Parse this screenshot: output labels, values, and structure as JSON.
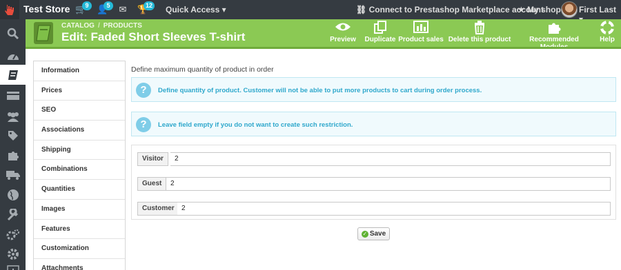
{
  "topbar": {
    "store_name": "Test Store",
    "badges": {
      "orders": "9",
      "customers": "5",
      "messages": "12"
    },
    "quick_access": "Quick Access",
    "connect": "Connect to Prestashop Marketplace account",
    "my_shop": "My shop",
    "user_name": "First Last"
  },
  "header": {
    "breadcrumb": [
      "Catalog",
      "Products"
    ],
    "title": "Edit: Faded Short Sleeves T-shirt",
    "toolbar": [
      "Preview",
      "Duplicate",
      "Product sales",
      "Delete this product",
      "Recommended Modules",
      "Help"
    ]
  },
  "tabs": [
    "Information",
    "Prices",
    "SEO",
    "Associations",
    "Shipping",
    "Combinations",
    "Quantities",
    "Images",
    "Features",
    "Customization",
    "Attachments"
  ],
  "content": {
    "heading": "Define maximum quantity of product in order",
    "alerts": [
      "Define quantity of product. Customer will not be able to put more products to cart during order process.",
      "Leave field empty if you do not want to create such restriction."
    ],
    "fields": [
      {
        "label": "Visitor",
        "value": "2"
      },
      {
        "label": "Guest",
        "value": "2"
      },
      {
        "label": "Customer",
        "value": "2"
      }
    ],
    "save_label": "Save"
  },
  "colors": {
    "header_green": "#8bc954",
    "topbar": "#353b41",
    "info_blue": "#2fa8cc",
    "badge": "#25b9d7"
  }
}
